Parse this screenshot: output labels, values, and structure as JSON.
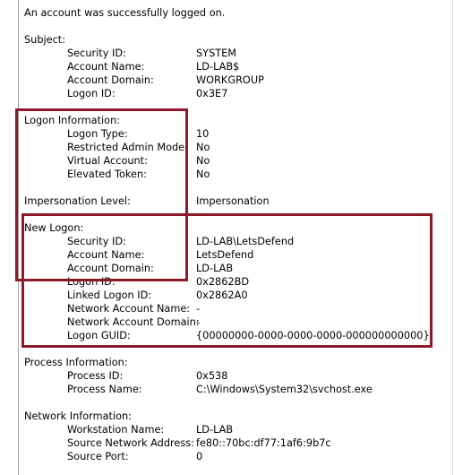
{
  "message": "An account was successfully logged on.",
  "subject": {
    "header": "Subject:",
    "fields": [
      {
        "label": "Security ID:",
        "value": "SYSTEM"
      },
      {
        "label": "Account Name:",
        "value": "LD-LAB$"
      },
      {
        "label": "Account Domain:",
        "value": "WORKGROUP"
      },
      {
        "label": "Logon ID:",
        "value": "0x3E7"
      }
    ]
  },
  "logon_info": {
    "header": "Logon Information:",
    "fields": [
      {
        "label": "Logon Type:",
        "value": "10"
      },
      {
        "label": "Restricted Admin Mode:",
        "value": "No"
      },
      {
        "label": "Virtual Account:",
        "value": "No"
      },
      {
        "label": "Elevated Token:",
        "value": "No"
      }
    ]
  },
  "impersonation": {
    "label": "Impersonation Level:",
    "value": "Impersonation"
  },
  "new_logon": {
    "header": "New Logon:",
    "fields": [
      {
        "label": "Security ID:",
        "value": "LD-LAB\\LetsDefend"
      },
      {
        "label": "Account Name:",
        "value": "LetsDefend"
      },
      {
        "label": "Account Domain:",
        "value": "LD-LAB"
      },
      {
        "label": "Logon ID:",
        "value": "0x2862BD"
      },
      {
        "label": "Linked Logon ID:",
        "value": "0x2862A0"
      },
      {
        "label": "Network Account Name:",
        "value": "-"
      },
      {
        "label": "Network Account Domain:",
        "value": "-"
      },
      {
        "label": "Logon GUID:",
        "value": "{00000000-0000-0000-0000-000000000000}"
      }
    ]
  },
  "process_info": {
    "header": "Process Information:",
    "fields": [
      {
        "label": "Process ID:",
        "value": "0x538"
      },
      {
        "label": "Process Name:",
        "value": "C:\\Windows\\System32\\svchost.exe"
      }
    ]
  },
  "network_info": {
    "header": "Network Information:",
    "fields": [
      {
        "label": "Workstation Name:",
        "value": "LD-LAB"
      },
      {
        "label": "Source Network Address:",
        "value": "fe80::70bc:df77:1af6:9b7c"
      },
      {
        "label": "Source Port:",
        "value": "0"
      }
    ]
  },
  "colors": {
    "highlight_box": "#8b1a2a",
    "text": "#000000",
    "background": "#ffffff"
  }
}
